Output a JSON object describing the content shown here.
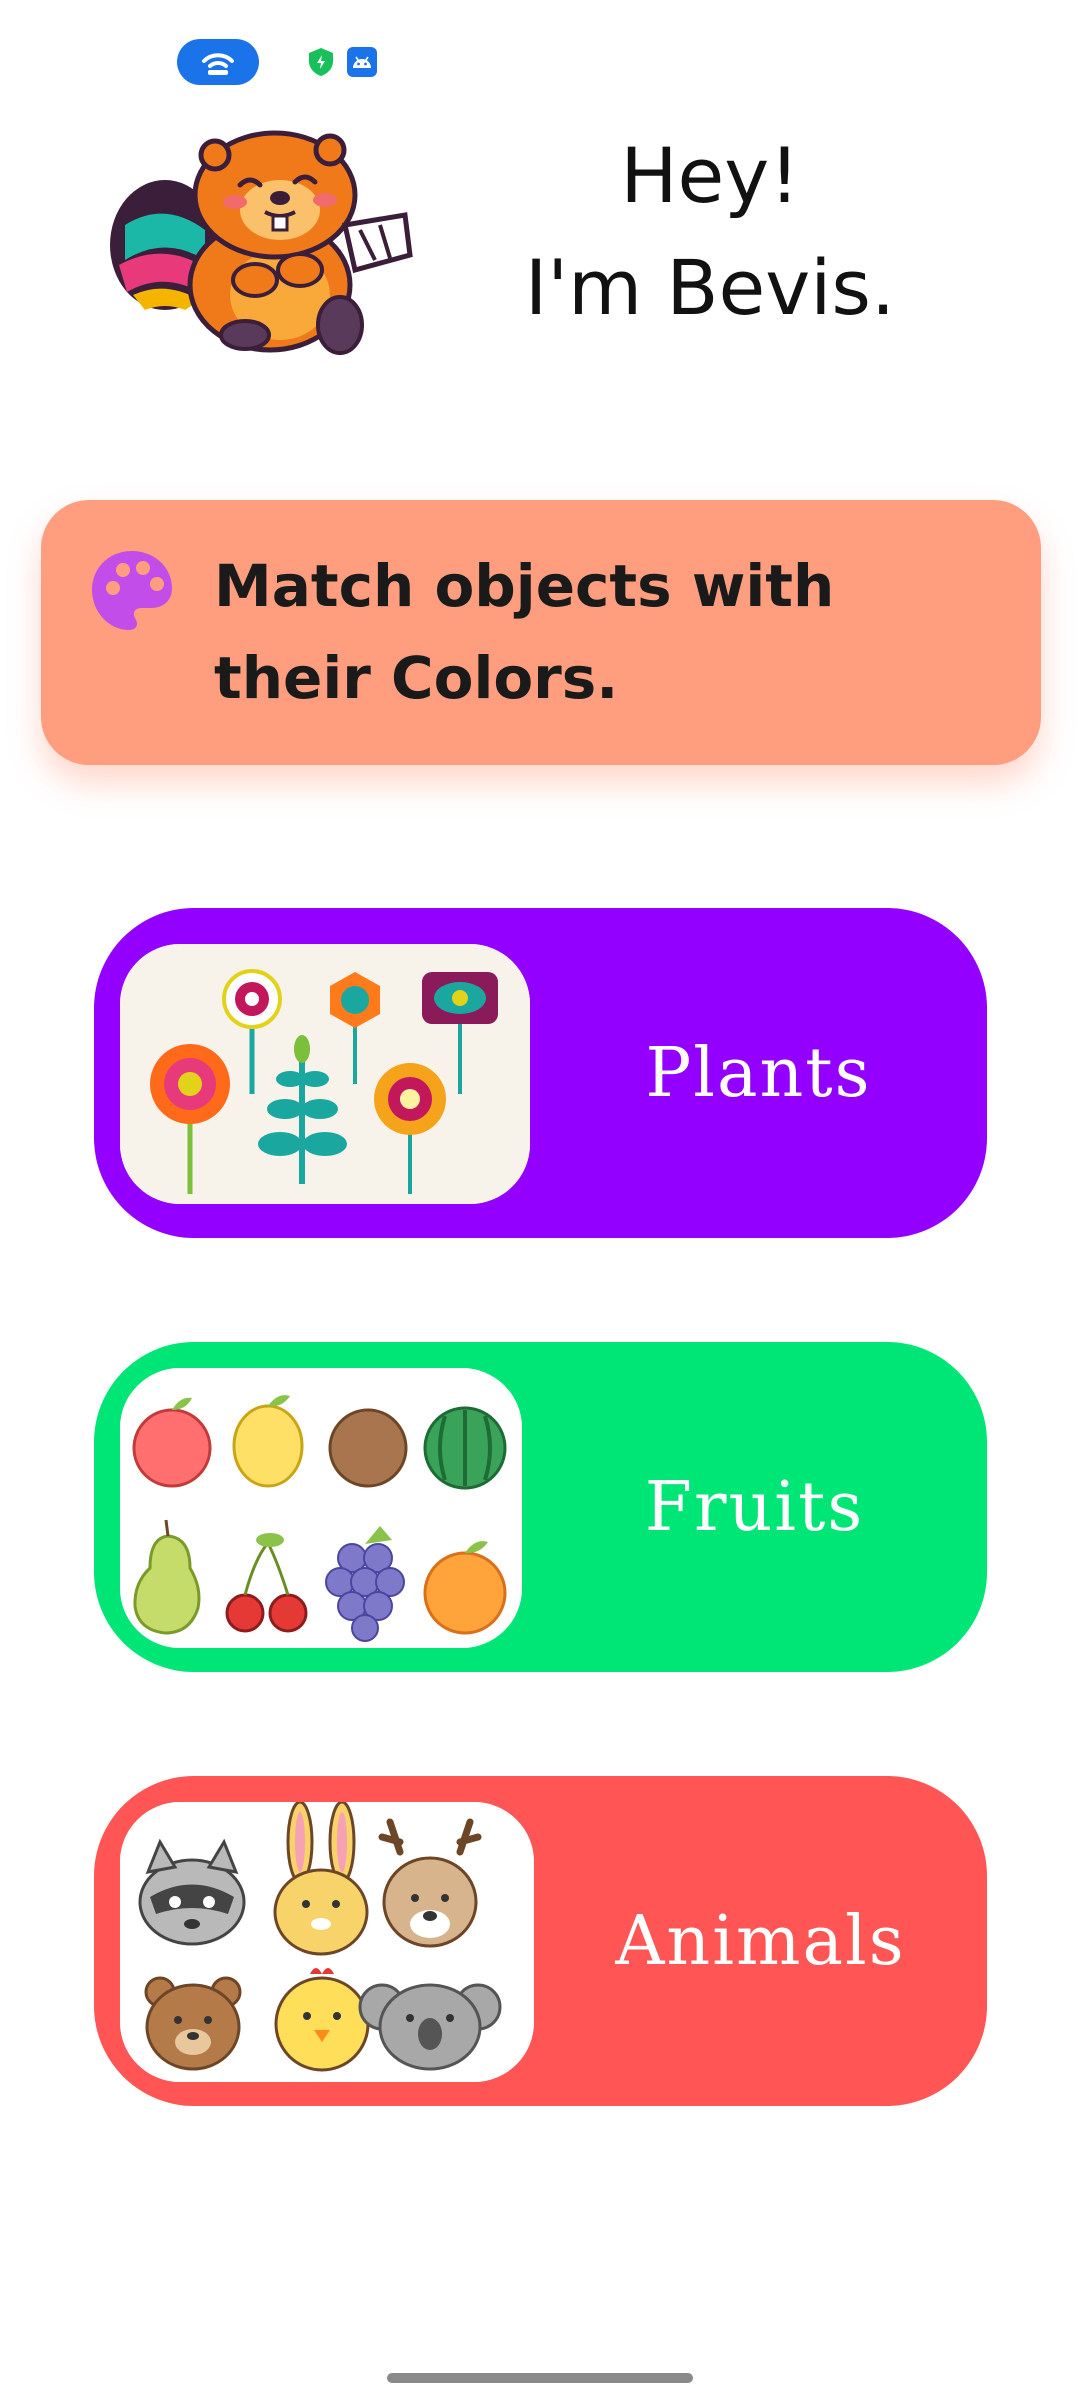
{
  "status_bar": {
    "icons": [
      "wifi-hotspot-icon",
      "shield-icon",
      "android-icon"
    ],
    "colors": {
      "pill": "#1a73e8",
      "shield": "#17c05a",
      "android": "#1a73e8"
    }
  },
  "header": {
    "mascot": "beaver-mascot",
    "greeting_line1": "Hey!",
    "greeting_line2": "I'm Bevis."
  },
  "instruction": {
    "icon": "palette-icon",
    "line1": "Match objects with",
    "line2": "their Colors.",
    "background": "#ff9e7f"
  },
  "categories": [
    {
      "label": "Plants",
      "color": "#9400ff",
      "image": "flowers-illustration"
    },
    {
      "label": "Fruits",
      "color": "#00e676",
      "image": "fruits-illustration"
    },
    {
      "label": "Animals",
      "color": "#ff5555",
      "image": "animal-faces-illustration"
    }
  ]
}
